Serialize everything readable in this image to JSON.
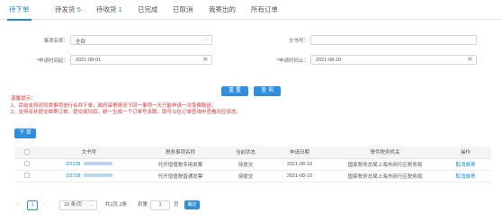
{
  "tabs": [
    {
      "label": "待下单",
      "count": ""
    },
    {
      "label": "待发货",
      "count": "5"
    },
    {
      "label": "待收货",
      "count": "1"
    },
    {
      "label": "已完成",
      "count": ""
    },
    {
      "label": "已取消",
      "count": ""
    },
    {
      "label": "我寄出的",
      "count": ""
    },
    {
      "label": "所有订单",
      "count": ""
    }
  ],
  "filters": {
    "matter_label": "事项名称：",
    "matter_value": "全部",
    "docno_label": "文书号：",
    "docno_value": "",
    "start_label": "申请时间起：",
    "start_value": "2021-08-01",
    "end_label": "申请时间止：",
    "end_value": "2021-08-10"
  },
  "buttons": {
    "reset": "重 置",
    "query": "查 询",
    "order": "下 单"
  },
  "tips": {
    "title": "温馨提示：",
    "line1": "1、目前支持对同类事项进行合并下单，政府采寄情况下同一事项一天只能申请一次免费配送。",
    "line2": "2、支持合并提交邮寄订单，提交成功后，统一生成一个订单号关联，即可以在订单查询中查看对应状态。"
  },
  "table": {
    "headers": [
      "文书号",
      "税务事项名称",
      "当前状态",
      "申请日期",
      "寄件税务机关",
      "操作"
    ],
    "rows": [
      {
        "doc_no": "D2108",
        "matter": "代开增值税专用发票",
        "status": "待提交",
        "date": "2021-08-10",
        "authority": "国家税务总局上海市闵行区税务局",
        "action": "取消邮寄"
      },
      {
        "doc_no": "D2108",
        "matter": "代开增值税普通发票",
        "status": "待提交",
        "date": "2021-08-10",
        "authority": "国家税务总局上海市闵行区税务局",
        "action": "取消邮寄"
      }
    ]
  },
  "pagination": {
    "prev": "‹",
    "page": "1",
    "next": "›",
    "page_size": "10 条/页",
    "total": "共1页,2条",
    "goto_label": "到第",
    "goto_value": "1",
    "page_unit": "页",
    "confirm": "确定"
  },
  "icons": {
    "dropdown": "chevron-down-icon",
    "calendar": "calendar-icon"
  },
  "colors": {
    "accent": "#1a8dd8",
    "button": "#2e8ee0",
    "warning": "#e0322f"
  }
}
